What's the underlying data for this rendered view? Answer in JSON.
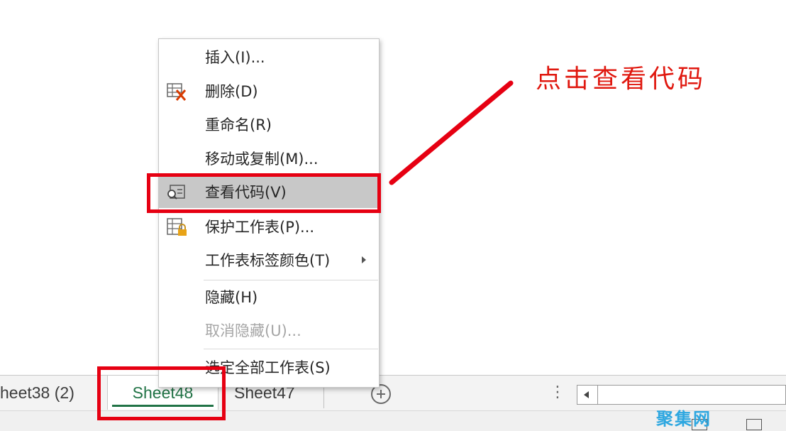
{
  "sheet_tabs": [
    {
      "label": "heet38 (2)",
      "active": false
    },
    {
      "label": "Sheet48",
      "active": true
    },
    {
      "label": "Sheet47",
      "active": false
    }
  ],
  "context_menu": {
    "items": [
      {
        "label": "插入(I)...",
        "icon": "",
        "disabled": false
      },
      {
        "label": "删除(D)",
        "icon": "delete-sheet-icon",
        "disabled": false
      },
      {
        "label": "重命名(R)",
        "icon": "",
        "disabled": false
      },
      {
        "label": "移动或复制(M)...",
        "icon": "",
        "disabled": false
      },
      {
        "label": "查看代码(V)",
        "icon": "view-code-icon",
        "disabled": false,
        "highlighted": true
      },
      {
        "label": "保护工作表(P)...",
        "icon": "protect-sheet-icon",
        "disabled": false
      },
      {
        "label": "工作表标签颜色(T)",
        "icon": "",
        "disabled": false,
        "submenu": true
      },
      {
        "label": "隐藏(H)",
        "icon": "",
        "disabled": false
      },
      {
        "label": "取消隐藏(U)...",
        "icon": "",
        "disabled": true
      },
      {
        "label": "选定全部工作表(S)",
        "icon": "",
        "disabled": false
      }
    ]
  },
  "annotation": {
    "text": "点击查看代码",
    "color": "#e0180f"
  },
  "watermark": {
    "text": "聚集网"
  },
  "colors": {
    "accent": "#217346",
    "highlight_box": "#e60012",
    "menu_highlight": "#c8c8c8"
  }
}
